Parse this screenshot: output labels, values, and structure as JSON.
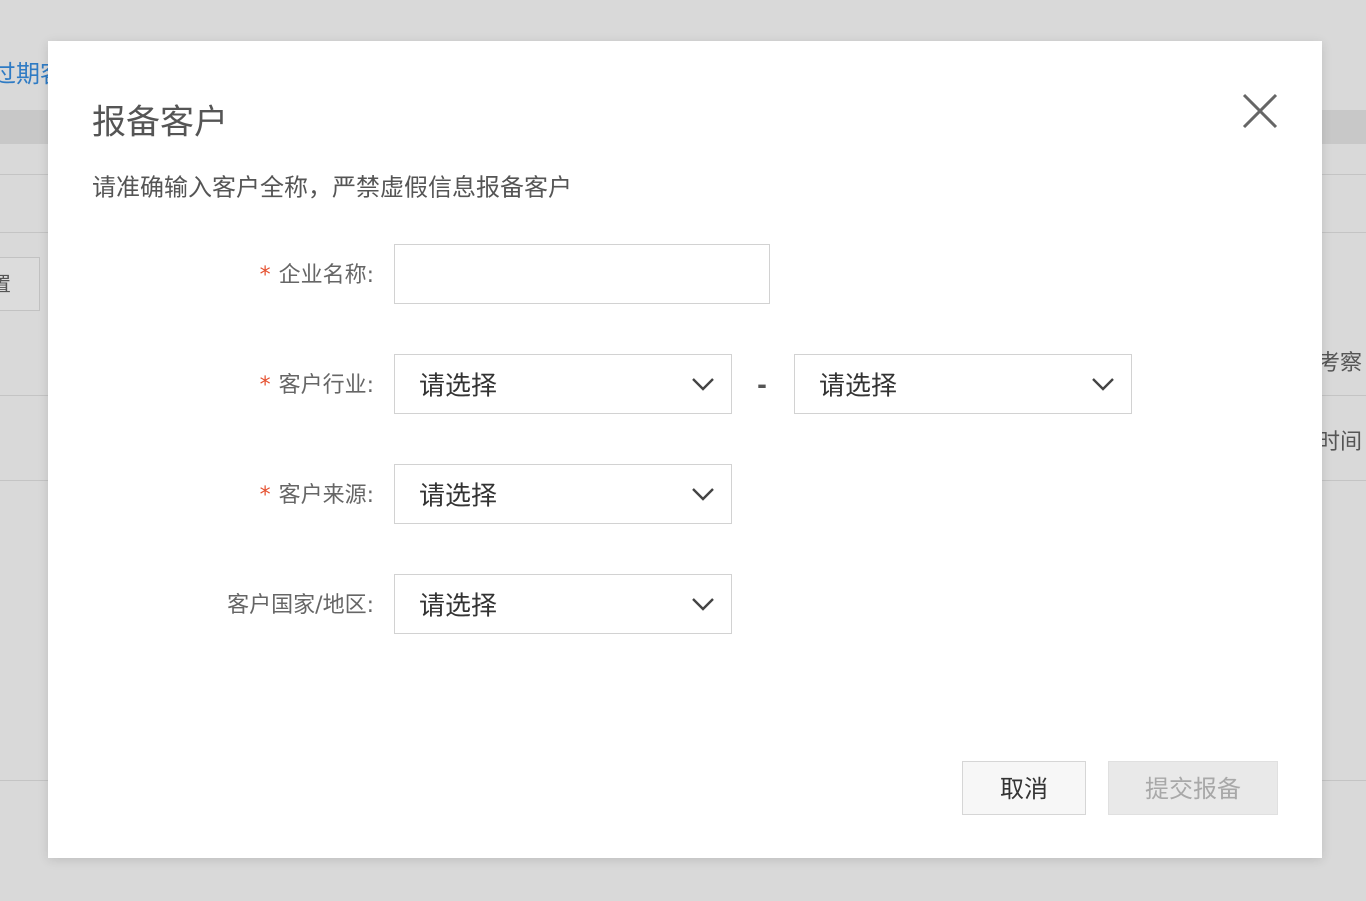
{
  "background": {
    "link_text": "过期客",
    "left_button_text": "置",
    "right_text_1": "考察",
    "right_text_2": "时间"
  },
  "modal": {
    "title": "报备客户",
    "notice": "请准确输入客户全称，严禁虚假信息报备客户",
    "required_mark": "*",
    "fields": {
      "company_name": {
        "label": "企业名称:",
        "value": "",
        "placeholder": ""
      },
      "industry": {
        "label": "客户行业:",
        "primary_value": "请选择",
        "secondary_value": "请选择",
        "separator": "-"
      },
      "source": {
        "label": "客户来源:",
        "value": "请选择"
      },
      "country": {
        "label": "客户国家/地区:",
        "value": "请选择"
      }
    },
    "buttons": {
      "cancel": "取消",
      "submit": "提交报备"
    }
  },
  "colors": {
    "accent_link": "#2f7bc4",
    "required": "#e5502f",
    "disabled_text": "#a8a8a8"
  },
  "icons": {
    "close": "close-icon",
    "dropdown": "chevron-down-icon"
  }
}
